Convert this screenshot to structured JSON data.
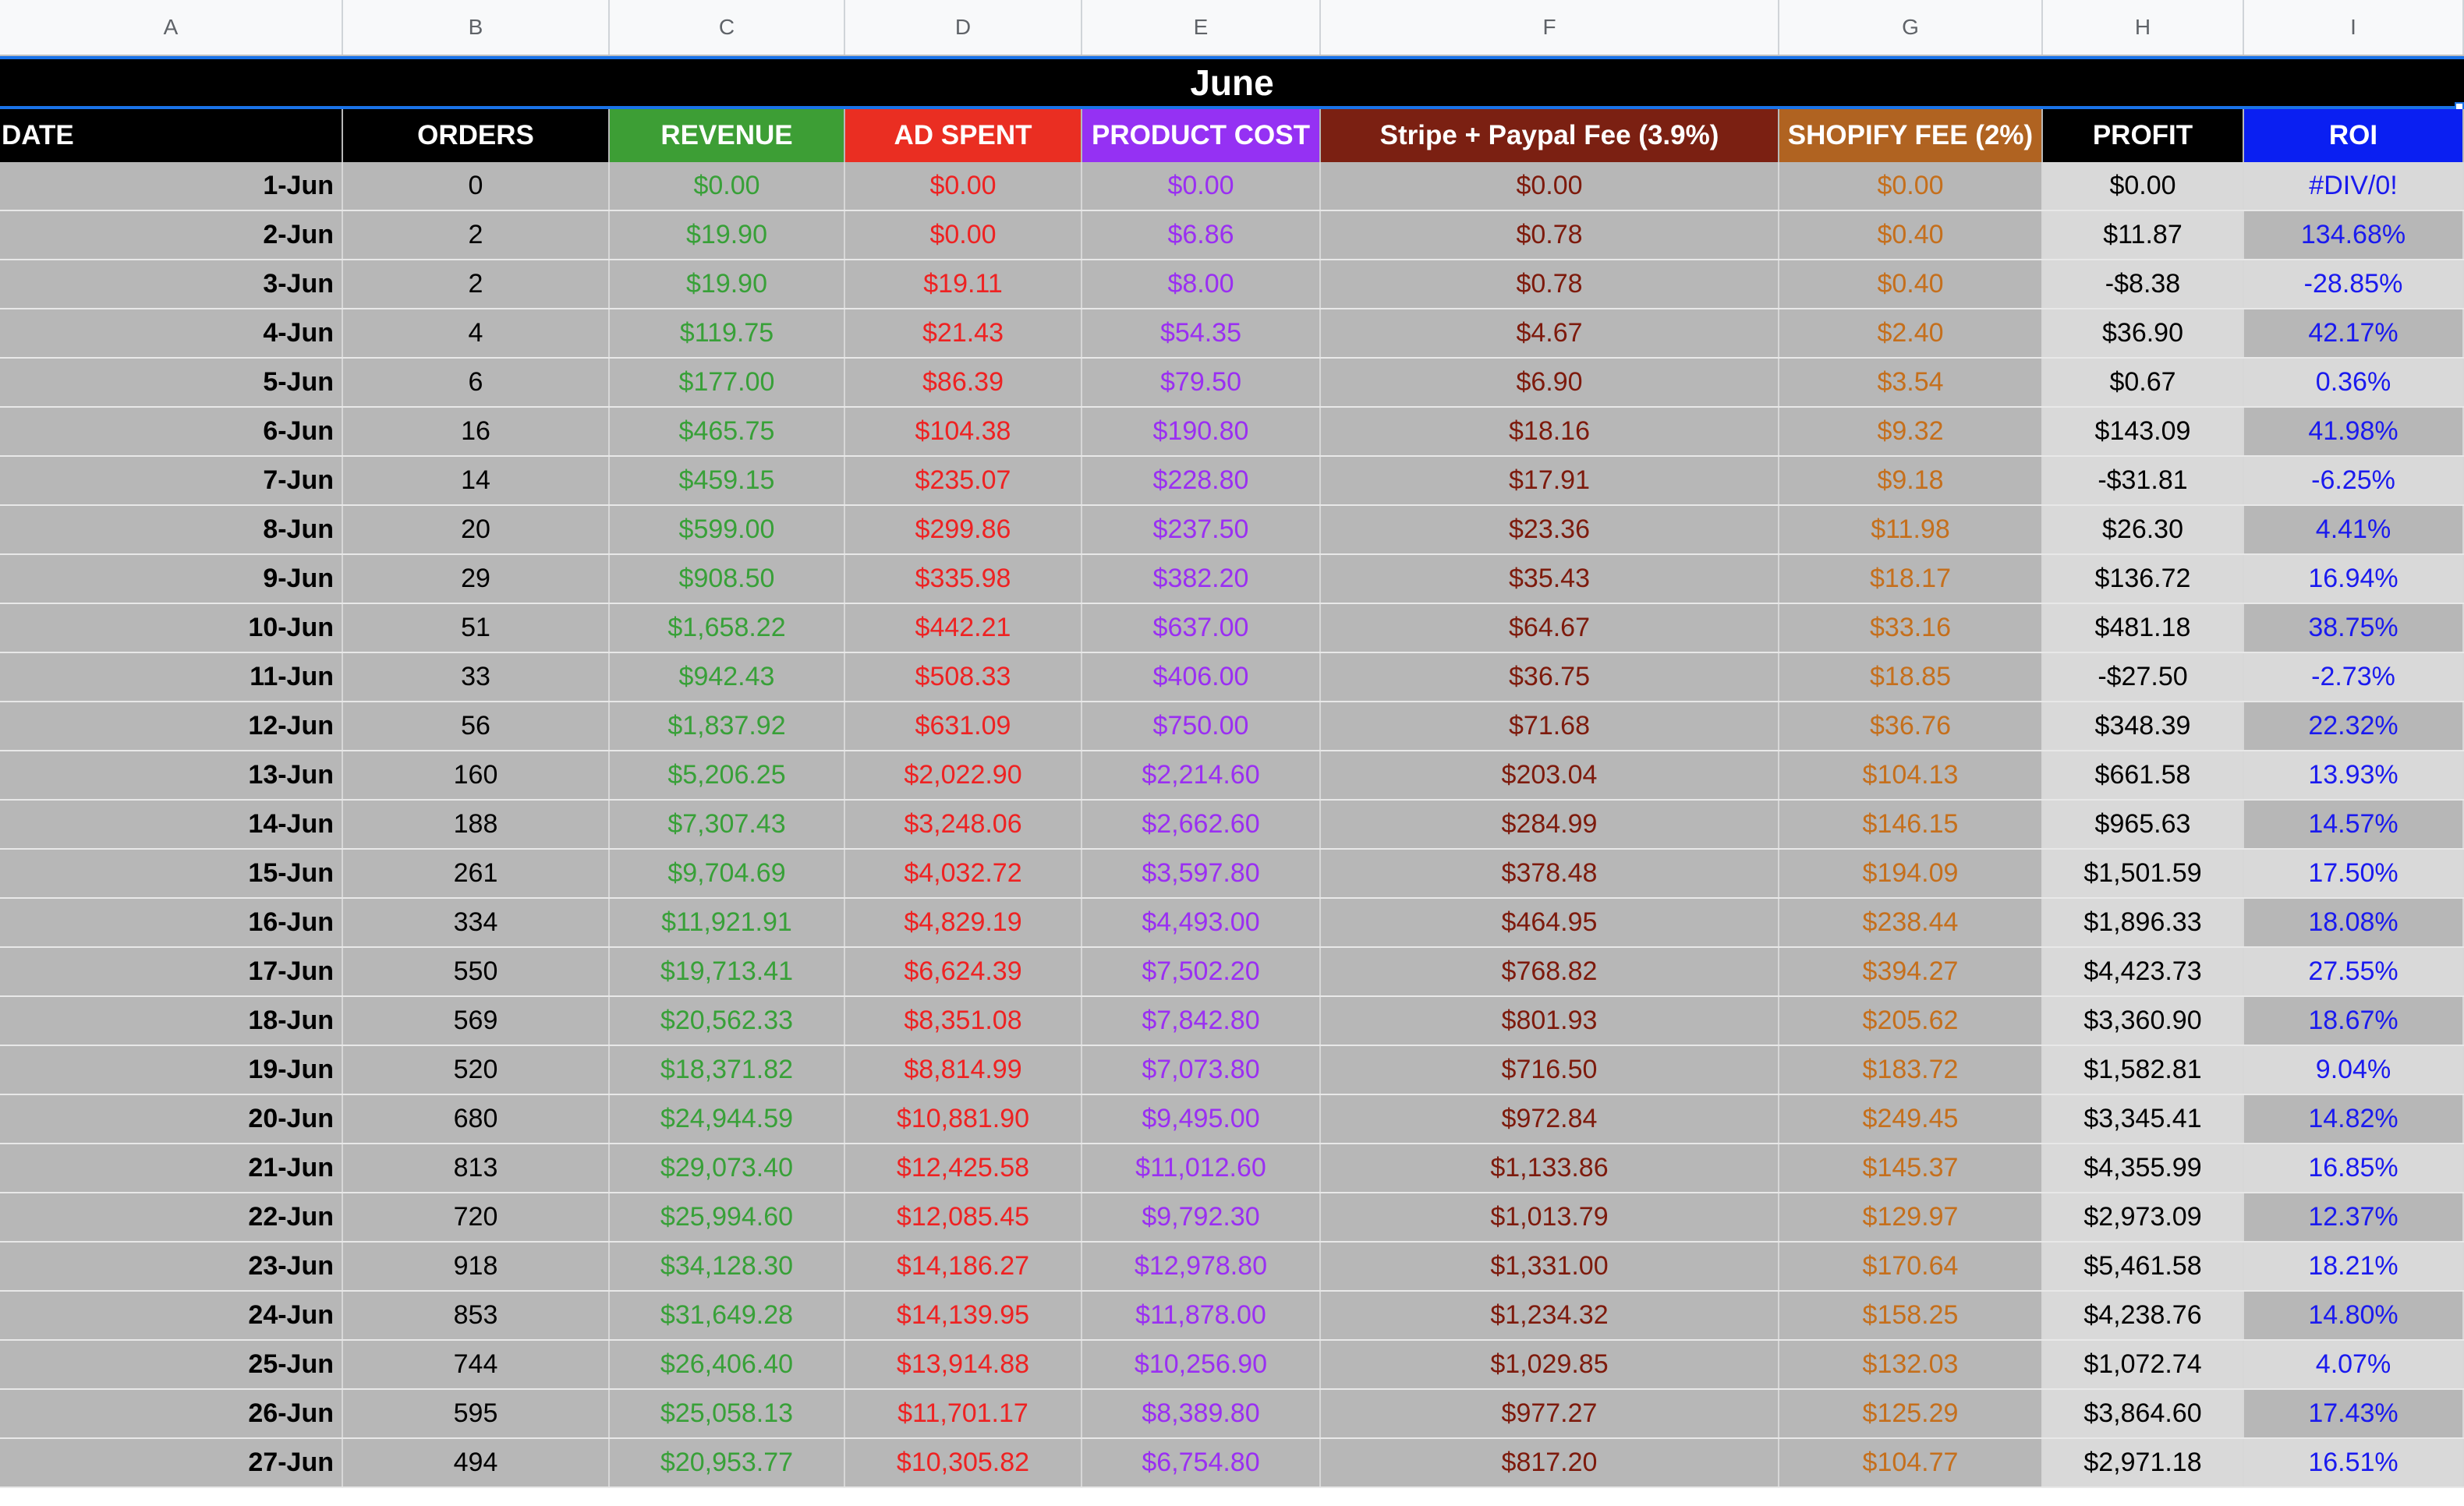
{
  "column_letters": [
    "A",
    "B",
    "C",
    "D",
    "E",
    "F",
    "G",
    "H",
    "I"
  ],
  "title": "June",
  "headers": {
    "date": "DATE",
    "orders": "ORDERS",
    "revenue": "REVENUE",
    "ad_spent": "AD SPENT",
    "product_cost": "PRODUCT COST",
    "stripe_fee": "Stripe + Paypal Fee (3.9%)",
    "shopify_fee": "SHOPIFY FEE (2%)",
    "profit": "PROFIT",
    "roi": "ROI"
  },
  "colors": {
    "revenue_header": "#3d9e35",
    "ad_spent_header": "#ea2e22",
    "product_cost_header": "#9531f3",
    "stripe_fee_header": "#7b2012",
    "shopify_fee_header": "#b06321",
    "profit_header": "#000000",
    "roi_header": "#0a1ff2",
    "date_header": "#000000",
    "orders_header": "#000000"
  },
  "rows": [
    {
      "date": "1-Jun",
      "orders": "0",
      "revenue": "$0.00",
      "ad_spent": "$0.00",
      "product_cost": "$0.00",
      "stripe_fee": "$0.00",
      "shopify_fee": "$0.00",
      "profit": "$0.00",
      "roi": "#DIV/0!"
    },
    {
      "date": "2-Jun",
      "orders": "2",
      "revenue": "$19.90",
      "ad_spent": "$0.00",
      "product_cost": "$6.86",
      "stripe_fee": "$0.78",
      "shopify_fee": "$0.40",
      "profit": "$11.87",
      "roi": "134.68%"
    },
    {
      "date": "3-Jun",
      "orders": "2",
      "revenue": "$19.90",
      "ad_spent": "$19.11",
      "product_cost": "$8.00",
      "stripe_fee": "$0.78",
      "shopify_fee": "$0.40",
      "profit": "-$8.38",
      "roi": "-28.85%"
    },
    {
      "date": "4-Jun",
      "orders": "4",
      "revenue": "$119.75",
      "ad_spent": "$21.43",
      "product_cost": "$54.35",
      "stripe_fee": "$4.67",
      "shopify_fee": "$2.40",
      "profit": "$36.90",
      "roi": "42.17%"
    },
    {
      "date": "5-Jun",
      "orders": "6",
      "revenue": "$177.00",
      "ad_spent": "$86.39",
      "product_cost": "$79.50",
      "stripe_fee": "$6.90",
      "shopify_fee": "$3.54",
      "profit": "$0.67",
      "roi": "0.36%"
    },
    {
      "date": "6-Jun",
      "orders": "16",
      "revenue": "$465.75",
      "ad_spent": "$104.38",
      "product_cost": "$190.80",
      "stripe_fee": "$18.16",
      "shopify_fee": "$9.32",
      "profit": "$143.09",
      "roi": "41.98%"
    },
    {
      "date": "7-Jun",
      "orders": "14",
      "revenue": "$459.15",
      "ad_spent": "$235.07",
      "product_cost": "$228.80",
      "stripe_fee": "$17.91",
      "shopify_fee": "$9.18",
      "profit": "-$31.81",
      "roi": "-6.25%"
    },
    {
      "date": "8-Jun",
      "orders": "20",
      "revenue": "$599.00",
      "ad_spent": "$299.86",
      "product_cost": "$237.50",
      "stripe_fee": "$23.36",
      "shopify_fee": "$11.98",
      "profit": "$26.30",
      "roi": "4.41%"
    },
    {
      "date": "9-Jun",
      "orders": "29",
      "revenue": "$908.50",
      "ad_spent": "$335.98",
      "product_cost": "$382.20",
      "stripe_fee": "$35.43",
      "shopify_fee": "$18.17",
      "profit": "$136.72",
      "roi": "16.94%"
    },
    {
      "date": "10-Jun",
      "orders": "51",
      "revenue": "$1,658.22",
      "ad_spent": "$442.21",
      "product_cost": "$637.00",
      "stripe_fee": "$64.67",
      "shopify_fee": "$33.16",
      "profit": "$481.18",
      "roi": "38.75%"
    },
    {
      "date": "11-Jun",
      "orders": "33",
      "revenue": "$942.43",
      "ad_spent": "$508.33",
      "product_cost": "$406.00",
      "stripe_fee": "$36.75",
      "shopify_fee": "$18.85",
      "profit": "-$27.50",
      "roi": "-2.73%"
    },
    {
      "date": "12-Jun",
      "orders": "56",
      "revenue": "$1,837.92",
      "ad_spent": "$631.09",
      "product_cost": "$750.00",
      "stripe_fee": "$71.68",
      "shopify_fee": "$36.76",
      "profit": "$348.39",
      "roi": "22.32%"
    },
    {
      "date": "13-Jun",
      "orders": "160",
      "revenue": "$5,206.25",
      "ad_spent": "$2,022.90",
      "product_cost": "$2,214.60",
      "stripe_fee": "$203.04",
      "shopify_fee": "$104.13",
      "profit": "$661.58",
      "roi": "13.93%"
    },
    {
      "date": "14-Jun",
      "orders": "188",
      "revenue": "$7,307.43",
      "ad_spent": "$3,248.06",
      "product_cost": "$2,662.60",
      "stripe_fee": "$284.99",
      "shopify_fee": "$146.15",
      "profit": "$965.63",
      "roi": "14.57%"
    },
    {
      "date": "15-Jun",
      "orders": "261",
      "revenue": "$9,704.69",
      "ad_spent": "$4,032.72",
      "product_cost": "$3,597.80",
      "stripe_fee": "$378.48",
      "shopify_fee": "$194.09",
      "profit": "$1,501.59",
      "roi": "17.50%"
    },
    {
      "date": "16-Jun",
      "orders": "334",
      "revenue": "$11,921.91",
      "ad_spent": "$4,829.19",
      "product_cost": "$4,493.00",
      "stripe_fee": "$464.95",
      "shopify_fee": "$238.44",
      "profit": "$1,896.33",
      "roi": "18.08%"
    },
    {
      "date": "17-Jun",
      "orders": "550",
      "revenue": "$19,713.41",
      "ad_spent": "$6,624.39",
      "product_cost": "$7,502.20",
      "stripe_fee": "$768.82",
      "shopify_fee": "$394.27",
      "profit": "$4,423.73",
      "roi": "27.55%"
    },
    {
      "date": "18-Jun",
      "orders": "569",
      "revenue": "$20,562.33",
      "ad_spent": "$8,351.08",
      "product_cost": "$7,842.80",
      "stripe_fee": "$801.93",
      "shopify_fee": "$205.62",
      "profit": "$3,360.90",
      "roi": "18.67%"
    },
    {
      "date": "19-Jun",
      "orders": "520",
      "revenue": "$18,371.82",
      "ad_spent": "$8,814.99",
      "product_cost": "$7,073.80",
      "stripe_fee": "$716.50",
      "shopify_fee": "$183.72",
      "profit": "$1,582.81",
      "roi": "9.04%"
    },
    {
      "date": "20-Jun",
      "orders": "680",
      "revenue": "$24,944.59",
      "ad_spent": "$10,881.90",
      "product_cost": "$9,495.00",
      "stripe_fee": "$972.84",
      "shopify_fee": "$249.45",
      "profit": "$3,345.41",
      "roi": "14.82%"
    },
    {
      "date": "21-Jun",
      "orders": "813",
      "revenue": "$29,073.40",
      "ad_spent": "$12,425.58",
      "product_cost": "$11,012.60",
      "stripe_fee": "$1,133.86",
      "shopify_fee": "$145.37",
      "profit": "$4,355.99",
      "roi": "16.85%"
    },
    {
      "date": "22-Jun",
      "orders": "720",
      "revenue": "$25,994.60",
      "ad_spent": "$12,085.45",
      "product_cost": "$9,792.30",
      "stripe_fee": "$1,013.79",
      "shopify_fee": "$129.97",
      "profit": "$2,973.09",
      "roi": "12.37%"
    },
    {
      "date": "23-Jun",
      "orders": "918",
      "revenue": "$34,128.30",
      "ad_spent": "$14,186.27",
      "product_cost": "$12,978.80",
      "stripe_fee": "$1,331.00",
      "shopify_fee": "$170.64",
      "profit": "$5,461.58",
      "roi": "18.21%"
    },
    {
      "date": "24-Jun",
      "orders": "853",
      "revenue": "$31,649.28",
      "ad_spent": "$14,139.95",
      "product_cost": "$11,878.00",
      "stripe_fee": "$1,234.32",
      "shopify_fee": "$158.25",
      "profit": "$4,238.76",
      "roi": "14.80%"
    },
    {
      "date": "25-Jun",
      "orders": "744",
      "revenue": "$26,406.40",
      "ad_spent": "$13,914.88",
      "product_cost": "$10,256.90",
      "stripe_fee": "$1,029.85",
      "shopify_fee": "$132.03",
      "profit": "$1,072.74",
      "roi": "4.07%"
    },
    {
      "date": "26-Jun",
      "orders": "595",
      "revenue": "$25,058.13",
      "ad_spent": "$11,701.17",
      "product_cost": "$8,389.80",
      "stripe_fee": "$977.27",
      "shopify_fee": "$125.29",
      "profit": "$3,864.60",
      "roi": "17.43%"
    },
    {
      "date": "27-Jun",
      "orders": "494",
      "revenue": "$20,953.77",
      "ad_spent": "$10,305.82",
      "product_cost": "$6,754.80",
      "stripe_fee": "$817.20",
      "shopify_fee": "$104.77",
      "profit": "$2,971.18",
      "roi": "16.51%"
    }
  ]
}
